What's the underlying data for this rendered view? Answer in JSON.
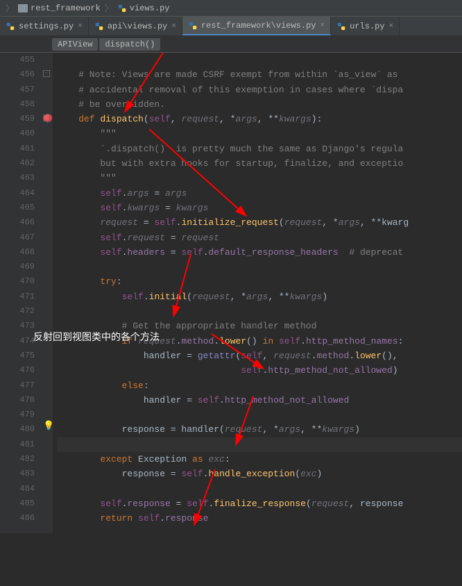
{
  "breadcrumb": {
    "folder": "rest_framework",
    "file": "views.py"
  },
  "tabs": [
    {
      "label": "settings.py",
      "active": false
    },
    {
      "label": "api\\views.py",
      "active": false
    },
    {
      "label": "rest_framework\\views.py",
      "active": true
    },
    {
      "label": "urls.py",
      "active": false
    }
  ],
  "context": {
    "class": "APIView",
    "method": "dispatch()"
  },
  "annotation": "反射回到视图类中的各个方法",
  "lines": [
    {
      "n": 455,
      "c": ""
    },
    {
      "n": 456,
      "c": "    # Note: Views are made CSRF exempt from within `as_view` as "
    },
    {
      "n": 457,
      "c": "    # accidental removal of this exemption in cases where `dispa"
    },
    {
      "n": 458,
      "c": "    # be overridden."
    },
    {
      "n": 459,
      "c": "    def dispatch(self, request, *args, **kwargs):"
    },
    {
      "n": 460,
      "c": "        \"\"\""
    },
    {
      "n": 461,
      "c": "        `.dispatch()` is pretty much the same as Django's regula"
    },
    {
      "n": 462,
      "c": "        but with extra hooks for startup, finalize, and exceptio"
    },
    {
      "n": 463,
      "c": "        \"\"\""
    },
    {
      "n": 464,
      "c": "        self.args = args"
    },
    {
      "n": 465,
      "c": "        self.kwargs = kwargs"
    },
    {
      "n": 466,
      "c": "        request = self.initialize_request(request, *args, **kwarg"
    },
    {
      "n": 467,
      "c": "        self.request = request"
    },
    {
      "n": 468,
      "c": "        self.headers = self.default_response_headers  # deprecat"
    },
    {
      "n": 469,
      "c": ""
    },
    {
      "n": 470,
      "c": "        try:"
    },
    {
      "n": 471,
      "c": "            self.initial(request, *args, **kwargs)"
    },
    {
      "n": 472,
      "c": ""
    },
    {
      "n": 473,
      "c": "            # Get the appropriate handler method"
    },
    {
      "n": 474,
      "c": "            if request.method.lower() in self.http_method_names:"
    },
    {
      "n": 475,
      "c": "                handler = getattr(self, request.method.lower(),"
    },
    {
      "n": 476,
      "c": "                                  self.http_method_not_allowed)"
    },
    {
      "n": 477,
      "c": "            else:"
    },
    {
      "n": 478,
      "c": "                handler = self.http_method_not_allowed"
    },
    {
      "n": 479,
      "c": ""
    },
    {
      "n": 480,
      "c": "            response = handler(request, *args, **kwargs)"
    },
    {
      "n": 481,
      "c": ""
    },
    {
      "n": 482,
      "c": "        except Exception as exc:"
    },
    {
      "n": 483,
      "c": "            response = self.handle_exception(exc)"
    },
    {
      "n": 484,
      "c": ""
    },
    {
      "n": 485,
      "c": "        self.response = self.finalize_response(request, response"
    },
    {
      "n": 486,
      "c": "        return self.response"
    }
  ]
}
